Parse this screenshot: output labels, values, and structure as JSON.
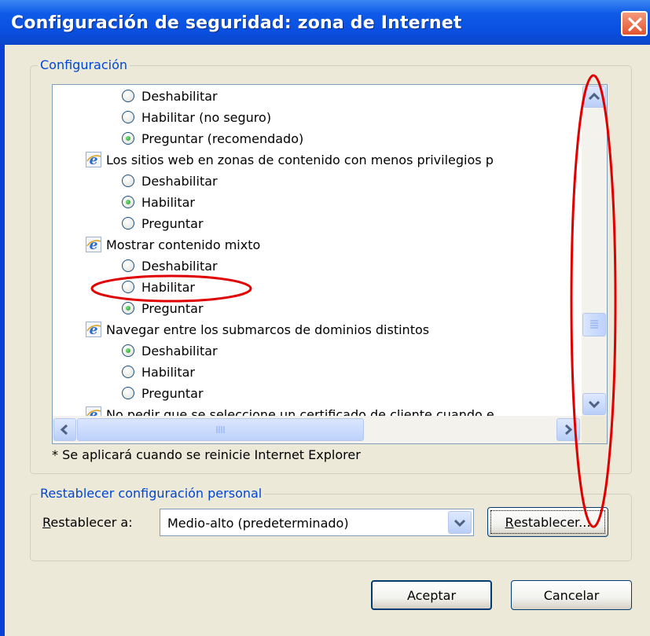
{
  "window": {
    "title": "Configuración de seguridad: zona de Internet",
    "close_icon": "close-icon"
  },
  "settings": {
    "legend": "Configuración",
    "rows": [
      {
        "type": "option",
        "label": "Deshabilitar",
        "checked": false
      },
      {
        "type": "option",
        "label": "Habilitar (no seguro)",
        "checked": false
      },
      {
        "type": "option",
        "label": "Preguntar (recomendado)",
        "checked": true
      },
      {
        "type": "heading",
        "label": "Los sitios web en zonas de contenido con menos privilegios p",
        "icon": "ie-icon"
      },
      {
        "type": "option",
        "label": "Deshabilitar",
        "checked": false
      },
      {
        "type": "option",
        "label": "Habilitar",
        "checked": true
      },
      {
        "type": "option",
        "label": "Preguntar",
        "checked": false
      },
      {
        "type": "heading",
        "label": "Mostrar contenido mixto",
        "icon": "ie-icon"
      },
      {
        "type": "option",
        "label": "Deshabilitar",
        "checked": false
      },
      {
        "type": "option",
        "label": "Habilitar",
        "checked": false
      },
      {
        "type": "option",
        "label": "Preguntar",
        "checked": true
      },
      {
        "type": "heading",
        "label": "Navegar entre los submarcos de dominios distintos",
        "icon": "ie-icon"
      },
      {
        "type": "option",
        "label": "Deshabilitar",
        "checked": true
      },
      {
        "type": "option",
        "label": "Habilitar",
        "checked": false
      },
      {
        "type": "option",
        "label": "Preguntar",
        "checked": false
      },
      {
        "type": "heading",
        "label": "No pedir que se seleccione un certificado de cliente cuando e",
        "icon": "ie-icon"
      }
    ],
    "horizontal_scroll_position": 0,
    "vertical_scroll_position": 0.68,
    "note": "* Se aplicará cuando se reinicie Internet Explorer"
  },
  "reset": {
    "legend": "Restablecer configuración personal",
    "label_mnemonic": "R",
    "label_rest": "establecer a:",
    "selected": "Medio-alto (predeterminado)",
    "button_mnemonic": "R",
    "button_rest": "establecer..."
  },
  "footer": {
    "ok": "Aceptar",
    "cancel": "Cancelar"
  },
  "colors": {
    "title_bar": "#0a4fe0",
    "dialog_bg": "#ece9d8",
    "group_legend": "#0046d5",
    "annotation": "#e00000"
  }
}
